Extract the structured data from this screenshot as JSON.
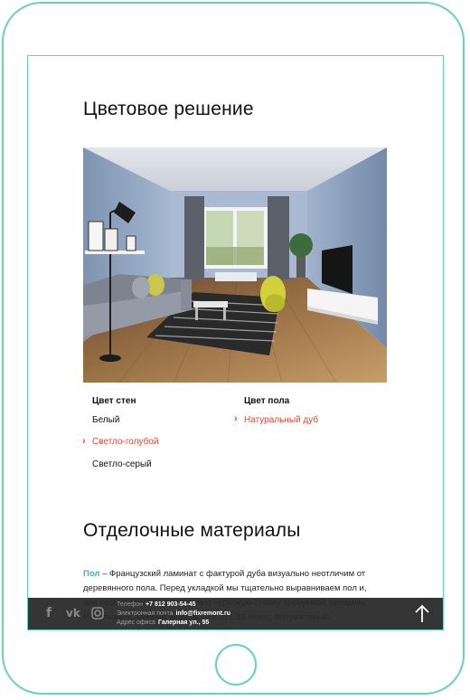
{
  "section1": {
    "title": "Цветовое решение"
  },
  "walls": {
    "heading": "Цвет стен",
    "options": [
      "Белый",
      "Светло-голубой",
      "Светло-серый"
    ],
    "selected": "Светло-голубой"
  },
  "floor": {
    "heading": "Цвет пола",
    "options": [
      "Натуральный дуб"
    ],
    "selected": "Натуральный дуб"
  },
  "section2": {
    "title": "Отделочные материалы",
    "highlight": "Пол",
    "paragraph": " – Французский ламинат с фактурой дуба визуально неотличим от деревянного пола. Перед укладкой мы тщательно выравниваем пол и, при необходимости, выполняем черновую стяжку требуемой толщины. Используем ламинат модель Osmoze 33 класс, полуматовый, однополосный, 1-слойный, длина 1200 мм, ширина"
  },
  "footer": {
    "phone_label": "Телефон",
    "phone_value": "+7 812 903-54-45",
    "email_label": "Электронная почта",
    "email_value": "info@fixremont.ru",
    "address_label": "Адрес офиса",
    "address_value": "Галерная ул., 55",
    "social_icons": [
      "facebook-icon",
      "vk-icon",
      "instagram-icon"
    ],
    "scroll_up_icon": "arrow-up-icon"
  },
  "colors": {
    "device_frame": "#63d3bd",
    "accent_selected": "#e8452f",
    "highlight_link": "#3bb5a9",
    "footer_bg": "#282828"
  }
}
